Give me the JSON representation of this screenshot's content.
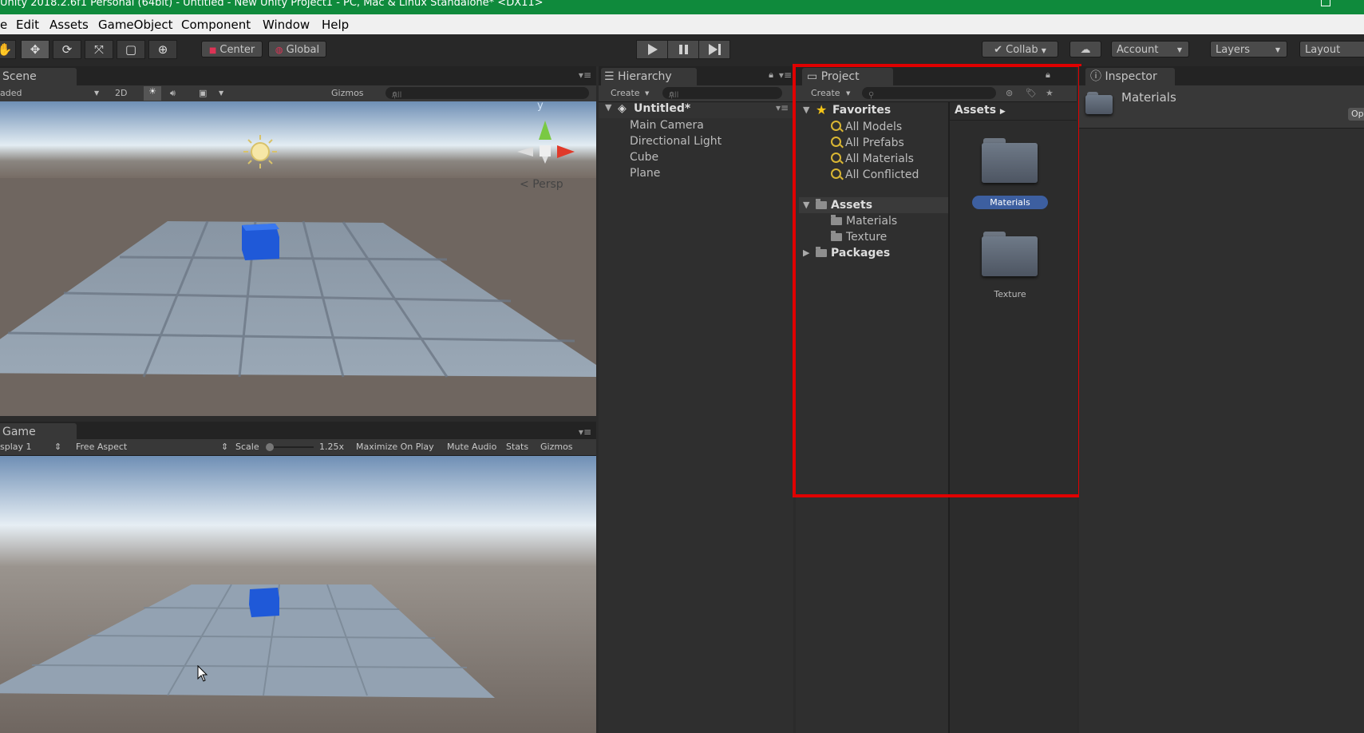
{
  "window": {
    "title": "Unity 2018.2.6f1 Personal (64bit) - Untitled - New Unity Project1 - PC, Mac & Linux Standalone* <DX11>"
  },
  "menu": [
    "e",
    "Edit",
    "Assets",
    "GameObject",
    "Component",
    "Window",
    "Help"
  ],
  "toolbar": {
    "center_label": "Center",
    "global_label": "Global",
    "collab_label": "Collab",
    "account_label": "Account",
    "layers_label": "Layers",
    "layout_label": "Layout"
  },
  "scene": {
    "tab_label": "Scene",
    "shading_mode": "aded",
    "mode_2d": "2D",
    "gizmos_label": "Gizmos",
    "search_placeholder": "All",
    "persp_label": "Persp",
    "axis_y_label": "y"
  },
  "game": {
    "tab_label": "Game",
    "display": "splay 1",
    "aspect": "Free Aspect",
    "scale_label": "Scale",
    "scale_value": "1.25x",
    "maximize_label": "Maximize On Play",
    "mute_label": "Mute Audio",
    "stats_label": "Stats",
    "gizmos_label": "Gizmos"
  },
  "hierarchy": {
    "tab_label": "Hierarchy",
    "create_label": "Create",
    "search_placeholder": "All",
    "scene_name": "Untitled*",
    "items": [
      "Main Camera",
      "Directional Light",
      "Cube",
      "Plane"
    ]
  },
  "project": {
    "tab_label": "Project",
    "create_label": "Create",
    "favorites_label": "Favorites",
    "favorites": [
      "All Models",
      "All Prefabs",
      "All Materials",
      "All Conflicted"
    ],
    "assets_label": "Assets",
    "asset_children": [
      "Materials",
      "Texture"
    ],
    "packages_label": "Packages",
    "breadcrumb": "Assets",
    "grid_items": [
      "Materials",
      "Texture"
    ],
    "selected_item": "Materials",
    "highlight_color": "#e00000"
  },
  "inspector": {
    "tab_label": "Inspector",
    "object_name": "Materials",
    "open_button": "Op"
  }
}
